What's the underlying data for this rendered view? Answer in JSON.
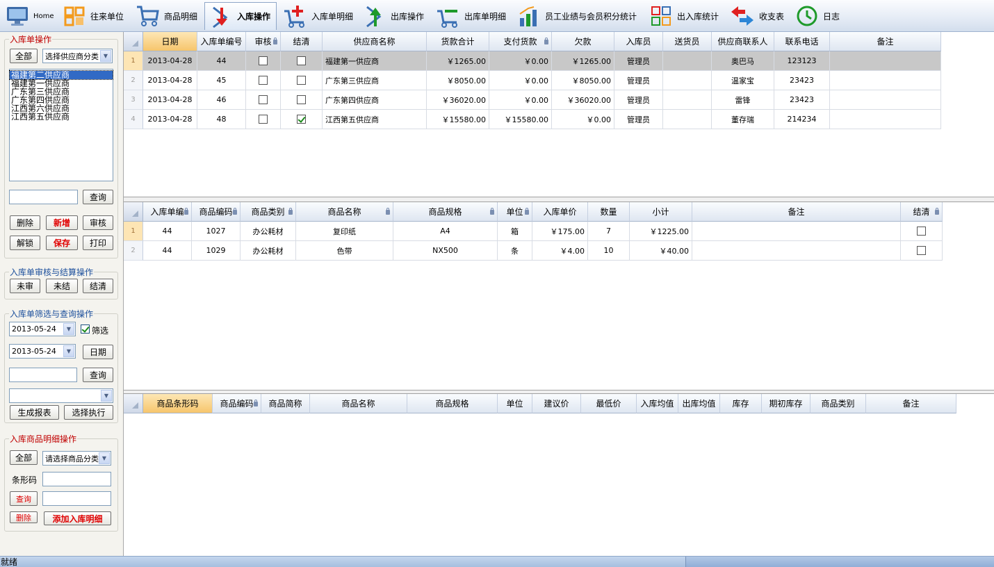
{
  "toolbar": {
    "items": [
      {
        "label": "Home",
        "icon": "monitor-icon"
      },
      {
        "label": "往来单位",
        "icon": "building-icon"
      },
      {
        "label": "商品明细",
        "icon": "cart-icon"
      },
      {
        "label": "入库操作",
        "icon": "arrow-down-icon"
      },
      {
        "label": "入库单明细",
        "icon": "cart-plus-icon"
      },
      {
        "label": "出库操作",
        "icon": "arrow-up-icon"
      },
      {
        "label": "出库单明细",
        "icon": "cart-minus-icon"
      },
      {
        "label": "员工业绩与会员积分统计",
        "icon": "bar-chart-icon"
      },
      {
        "label": "出入库统计",
        "icon": "grid-icon"
      },
      {
        "label": "收支表",
        "icon": "exchange-icon"
      },
      {
        "label": "日志",
        "icon": "clock-icon"
      }
    ]
  },
  "left": {
    "group1_title": "入库单操作",
    "all_btn": "全部",
    "supplier_category": "选择供应商分类",
    "suppliers": [
      "福建第二供应商",
      "福建第一供应商",
      "广东第三供应商",
      "广东第四供应商",
      "江西第六供应商",
      "江西第五供应商"
    ],
    "query_btn": "查询",
    "delete_btn": "删除",
    "new_btn": "新增",
    "audit_btn": "审核",
    "unlock_btn": "解锁",
    "save_btn": "保存",
    "print_btn": "打印",
    "group2_title": "入库单审核与结算操作",
    "unaudited_btn": "未审",
    "unsettled_btn": "未结",
    "settle_btn": "结清",
    "group3_title": "入库单筛选与查询操作",
    "date_from": "2013-05-24",
    "filter_label": "筛选",
    "date_to": "2013-05-24",
    "date_btn": "日期",
    "query2_btn": "查询",
    "report_btn": "生成报表",
    "execute_btn": "选择执行",
    "group4_title": "入库商品明细操作",
    "all2_btn": "全部",
    "goods_category": "请选择商品分类",
    "barcode_label": "条形码",
    "query3_btn": "查询",
    "delete2_btn": "删除",
    "add_detail_btn": "添加入库明细"
  },
  "orders": {
    "headers": [
      "日期",
      "入库单编号",
      "审核",
      "结清",
      "供应商名称",
      "货款合计",
      "支付货款",
      "欠款",
      "入库员",
      "送货员",
      "供应商联系人",
      "联系电话",
      "备注"
    ],
    "rows": [
      {
        "n": "1",
        "date": "2013-04-28",
        "no": "44",
        "audit": false,
        "settled": false,
        "supplier": "福建第一供应商",
        "total": "￥1265.00",
        "paid": "￥0.00",
        "owed": "￥1265.00",
        "clerk": "管理员",
        "courier": "",
        "contact": "奥巴马",
        "phone": "123123",
        "note": ""
      },
      {
        "n": "2",
        "date": "2013-04-28",
        "no": "45",
        "audit": false,
        "settled": false,
        "supplier": "广东第三供应商",
        "total": "￥8050.00",
        "paid": "￥0.00",
        "owed": "￥8050.00",
        "clerk": "管理员",
        "courier": "",
        "contact": "温家宝",
        "phone": "23423",
        "note": ""
      },
      {
        "n": "3",
        "date": "2013-04-28",
        "no": "46",
        "audit": false,
        "settled": false,
        "supplier": "广东第四供应商",
        "total": "￥36020.00",
        "paid": "￥0.00",
        "owed": "￥36020.00",
        "clerk": "管理员",
        "courier": "",
        "contact": "雷锋",
        "phone": "23423",
        "note": ""
      },
      {
        "n": "4",
        "date": "2013-04-28",
        "no": "48",
        "audit": false,
        "settled": true,
        "supplier": "江西第五供应商",
        "total": "￥15580.00",
        "paid": "￥15580.00",
        "owed": "￥0.00",
        "clerk": "管理员",
        "courier": "",
        "contact": "董存瑞",
        "phone": "214234",
        "note": ""
      }
    ]
  },
  "details": {
    "headers": [
      "入库单编",
      "商品编码",
      "商品类别",
      "商品名称",
      "商品规格",
      "单位",
      "入库单价",
      "数量",
      "小计",
      "备注",
      "结清"
    ],
    "rows": [
      {
        "n": "1",
        "order": "44",
        "code": "1027",
        "category": "办公耗材",
        "name": "复印纸",
        "spec": "A4",
        "unit": "箱",
        "price": "￥175.00",
        "qty": "7",
        "subtotal": "￥1225.00",
        "note": "",
        "settled": false
      },
      {
        "n": "2",
        "order": "44",
        "code": "1029",
        "category": "办公耗材",
        "name": "色带",
        "spec": "NX500",
        "unit": "条",
        "price": "￥4.00",
        "qty": "10",
        "subtotal": "￥40.00",
        "note": "",
        "settled": false
      }
    ]
  },
  "goods": {
    "headers": [
      "商品条形码",
      "商品编码",
      "商品简称",
      "商品名称",
      "商品规格",
      "单位",
      "建议价",
      "最低价",
      "入库均值",
      "出库均值",
      "库存",
      "期初库存",
      "商品类别",
      "备注"
    ]
  },
  "status": {
    "text": "就绪"
  }
}
